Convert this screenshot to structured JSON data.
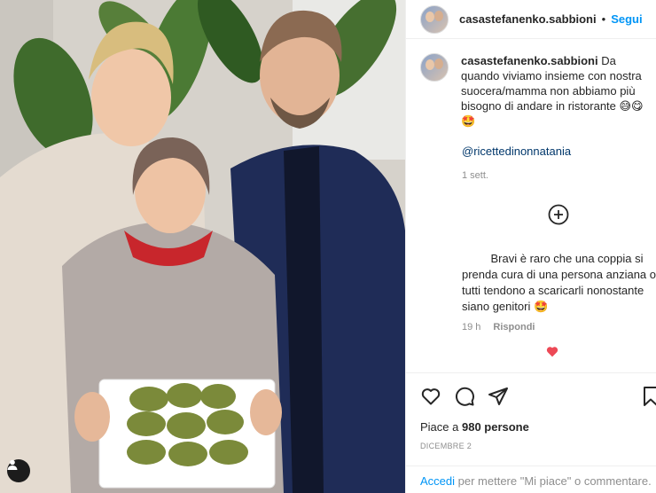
{
  "post": {
    "username": "casastefanenko.sabbioni",
    "follow_label": "Segui",
    "separator": "•"
  },
  "caption": {
    "username": "casastefanenko.sabbioni",
    "text": "Da quando viviamo insieme con nostra suocera/mamma non abbiamo più bisogno di andare in ristorante 😅😋🤩",
    "mention": "@ricettedinonnatania",
    "time": "1 sett."
  },
  "reply": {
    "lines": [
      "         Bravi è raro che una coppia si",
      "prenda cura di una persona anziana og",
      "tutti tendono a scaricarli nonostante",
      "siano genitori 🤩"
    ],
    "time": "19 h",
    "reply_label": "Rispondi"
  },
  "likes": {
    "prefix": "Piace a ",
    "count": "980 persone"
  },
  "date": "DICEMBRE 2",
  "footer": {
    "login_label": "Accedi",
    "rest": " per mettere \"Mi piace\" o commentare."
  },
  "icons": {
    "like": "heart-icon",
    "comment": "comment-icon",
    "share": "share-icon",
    "save": "bookmark-icon",
    "more_comments": "plus-circle-icon",
    "tagged_users": "user-icon"
  },
  "colors": {
    "follow": "#0095f6",
    "like_red": "#ed4956",
    "text": "#262626",
    "muted": "#8e8e8e"
  }
}
